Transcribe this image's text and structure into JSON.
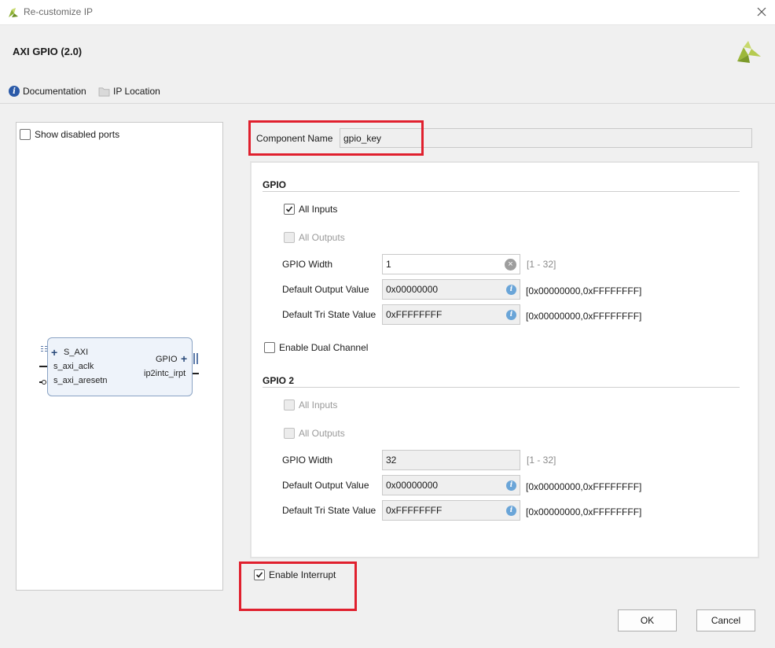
{
  "window": {
    "title": "Re-customize IP"
  },
  "header": {
    "ip_title": "AXI GPIO (2.0)",
    "documentation_label": "Documentation",
    "ip_location_label": "IP Location"
  },
  "left_panel": {
    "show_disabled_ports_label": "Show disabled ports",
    "block": {
      "ports_left": [
        "S_AXI",
        "s_axi_aclk",
        "s_axi_aresetn"
      ],
      "ports_right": [
        "GPIO",
        "ip2intc_irpt"
      ]
    }
  },
  "component": {
    "label": "Component Name",
    "value": "gpio_key"
  },
  "gpio": {
    "title": "GPIO",
    "all_inputs": "All Inputs",
    "all_outputs": "All Outputs",
    "width_label": "GPIO Width",
    "width_value": "1",
    "width_range": "[1 - 32]",
    "default_output_label": "Default Output Value",
    "default_output_value": "0x00000000",
    "default_output_range": "[0x00000000,0xFFFFFFFF]",
    "default_tri_label": "Default Tri State Value",
    "default_tri_value": "0xFFFFFFFF",
    "default_tri_range": "[0x00000000,0xFFFFFFFF]",
    "enable_dual_label": "Enable Dual Channel"
  },
  "gpio2": {
    "title": "GPIO 2",
    "all_inputs": "All Inputs",
    "all_outputs": "All Outputs",
    "width_label": "GPIO Width",
    "width_value": "32",
    "width_range": "[1 - 32]",
    "default_output_label": "Default Output Value",
    "default_output_value": "0x00000000",
    "default_output_range": "[0x00000000,0xFFFFFFFF]",
    "default_tri_label": "Default Tri State Value",
    "default_tri_value": "0xFFFFFFFF",
    "default_tri_range": "[0x00000000,0xFFFFFFFF]"
  },
  "interrupt": {
    "label": "Enable Interrupt"
  },
  "buttons": {
    "ok": "OK",
    "cancel": "Cancel"
  },
  "colors": {
    "highlight_red": "#e0202e",
    "accent_blue": "#2b5aa8"
  }
}
